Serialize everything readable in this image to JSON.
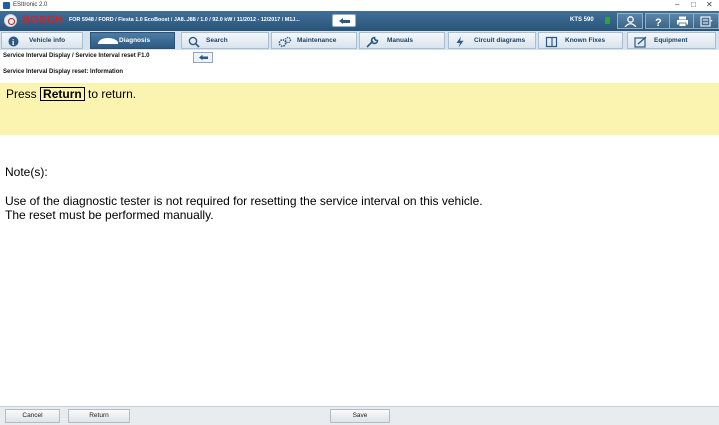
{
  "window": {
    "title": "ESItronic 2.0",
    "controls": {
      "minimize": "–",
      "maximize": "□",
      "close": "✕"
    }
  },
  "header": {
    "brand": "BOSCH",
    "vehicle": "FOR 5948 / FORD / Fiesta 1.0 EcoBoost / JA8..J88 / 1.0 / 92.0 kW / 11/2012 - 12/2017 / M1J...",
    "device": "KTS 590",
    "icons": [
      "user-icon",
      "help-icon",
      "print-icon",
      "menu-icon"
    ]
  },
  "tabs": [
    {
      "label": "Vehicle info",
      "icon": "info-icon",
      "active": false
    },
    {
      "label": "Diagnosis",
      "icon": "car-icon",
      "active": true
    },
    {
      "label": "Search",
      "icon": "search-icon",
      "active": false
    },
    {
      "label": "Maintenance",
      "icon": "gears-icon",
      "active": false
    },
    {
      "label": "Manuals",
      "icon": "wrench-icon",
      "active": false
    },
    {
      "label": "Circuit diagrams",
      "icon": "lightning-icon",
      "active": false
    },
    {
      "label": "Known Fixes",
      "icon": "book-icon",
      "active": false
    },
    {
      "label": "Equipment",
      "icon": "equipment-icon",
      "active": false
    }
  ],
  "breadcrumb": "Service Interval Display / Service Interval reset F1.0",
  "subtitle": "Service Interval Display reset: Information",
  "message": {
    "prefix": "Press",
    "key": "Return",
    "suffix": "to return."
  },
  "notes": {
    "title": "Note(s):",
    "lines": [
      "Use of the diagnostic tester is not required for resetting the service interval on this vehicle.",
      "The reset must be performed manually."
    ]
  },
  "footer": {
    "cancel": "Cancel",
    "return": "Return",
    "save": "Save"
  },
  "colors": {
    "header": "#2f5b82",
    "brand": "#e11d23",
    "highlight": "#fbf3b0",
    "status_led": "#2fa33a"
  }
}
